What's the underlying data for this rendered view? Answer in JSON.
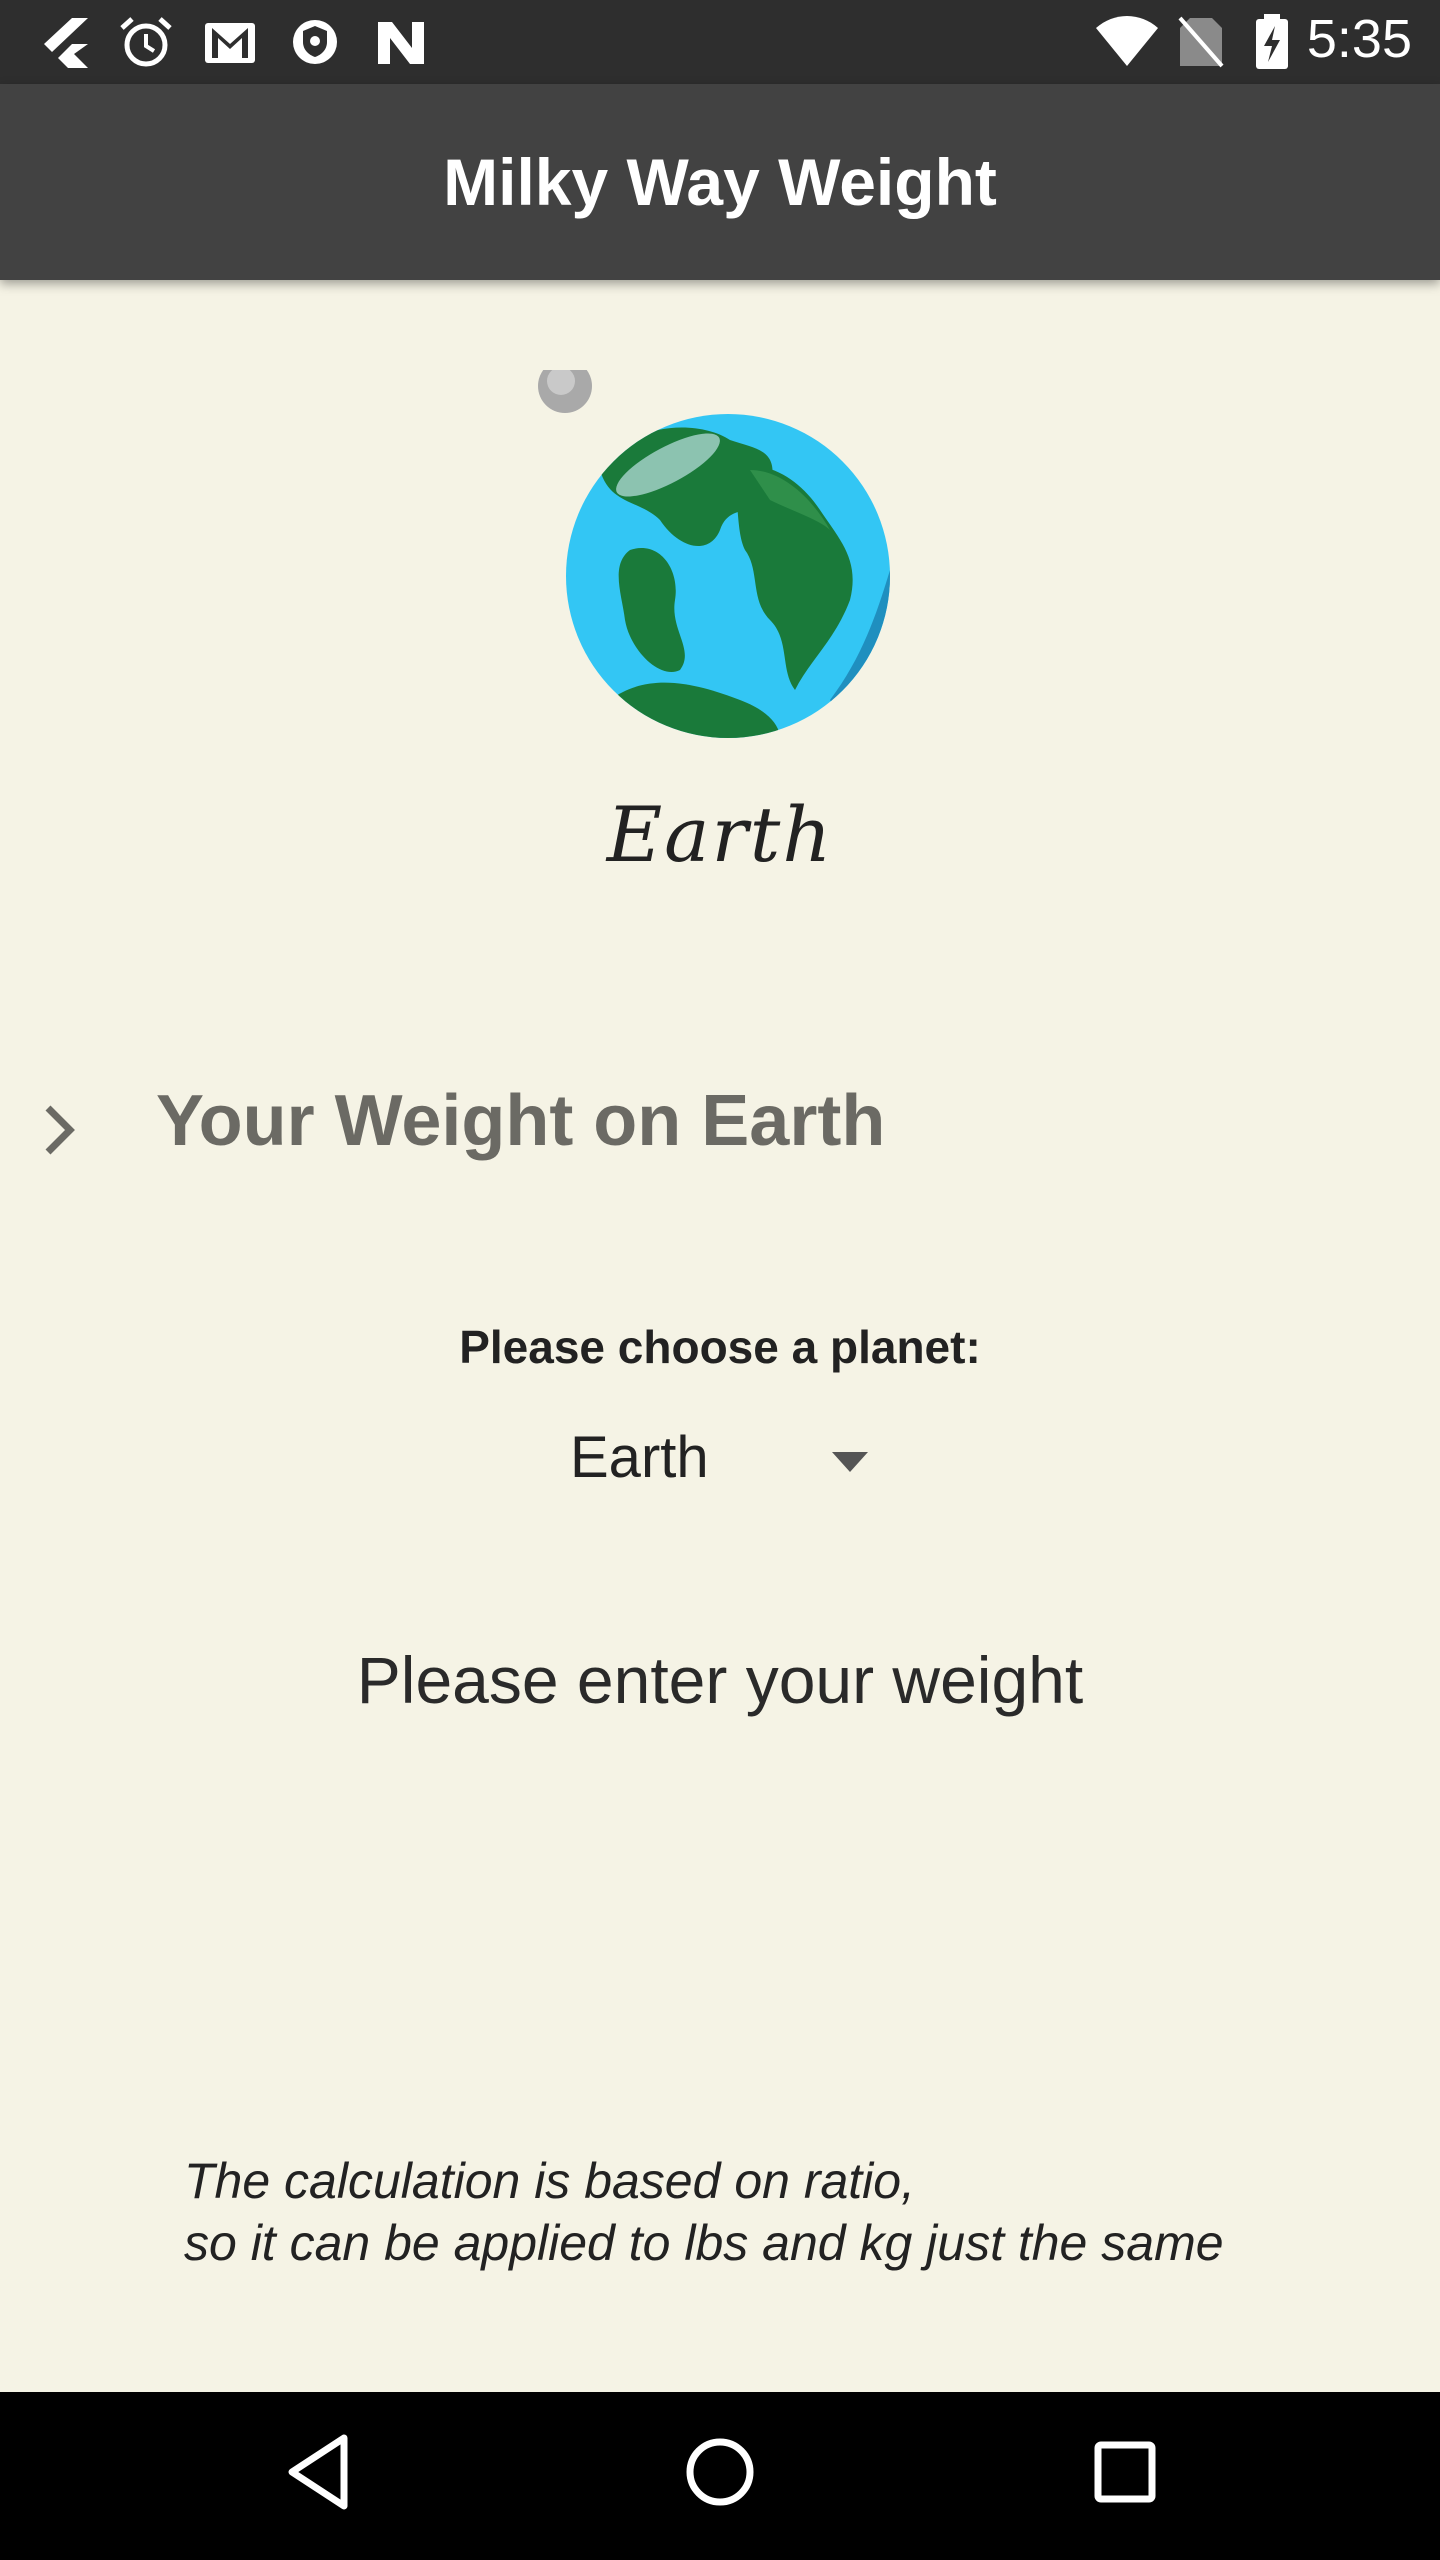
{
  "status_bar": {
    "time": "5:35",
    "left_icons": [
      "flutter-icon",
      "alarm-icon",
      "gmail-icon",
      "shield-icon",
      "n-icon"
    ],
    "right_icons": [
      "wifi-icon",
      "no-sim-icon",
      "battery-charging-icon"
    ]
  },
  "app_bar": {
    "title": "Milky Way Weight"
  },
  "planet": {
    "image": "earth-planet-icon",
    "name": "Earth"
  },
  "weight_field": {
    "label": "Your Weight on Earth",
    "icon": "chevron-right-icon"
  },
  "planet_selector": {
    "label": "Please choose a planet:",
    "selected": "Earth"
  },
  "prompt": "Please enter your weight",
  "note": {
    "line1": "The calculation is based on ratio,",
    "line2": "so it can be applied to lbs and kg just the same"
  },
  "colors": {
    "background": "#f5f3e5",
    "app_bar": "#424242",
    "status_bar": "#2e2e2e",
    "muted_text": "#6b6a64"
  }
}
